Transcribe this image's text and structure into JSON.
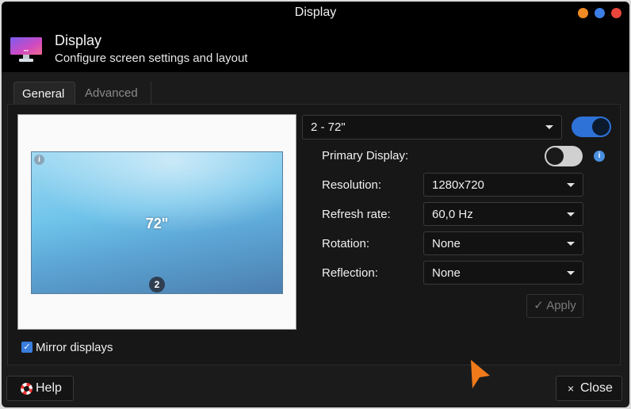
{
  "window": {
    "title": "Display"
  },
  "header": {
    "title": "Display",
    "subtitle": "Configure screen settings and layout",
    "icon": "monitor-icon"
  },
  "tabs": [
    {
      "label": "General",
      "active": true
    },
    {
      "label": "Advanced",
      "active": false
    }
  ],
  "preview": {
    "size_label": "72\"",
    "display_number": "2",
    "info_glyph": "i"
  },
  "display_select": {
    "value": "2 -  72\""
  },
  "display_enabled": true,
  "settings": {
    "primary_label": "Primary Display:",
    "primary_enabled": false,
    "resolution_label": "Resolution:",
    "resolution_value": "1280x720",
    "refresh_label": "Refresh rate:",
    "refresh_value": "60,0 Hz",
    "rotation_label": "Rotation:",
    "rotation_value": "None",
    "reflection_label": "Reflection:",
    "reflection_value": "None",
    "apply_label": "✓ Apply"
  },
  "mirror": {
    "label": "Mirror displays",
    "checked": true
  },
  "footer": {
    "help_label": "Help",
    "close_label": "Close",
    "close_glyph": "×"
  },
  "colors": {
    "accent": "#2e72d8",
    "cursor": "#f07a1a"
  }
}
